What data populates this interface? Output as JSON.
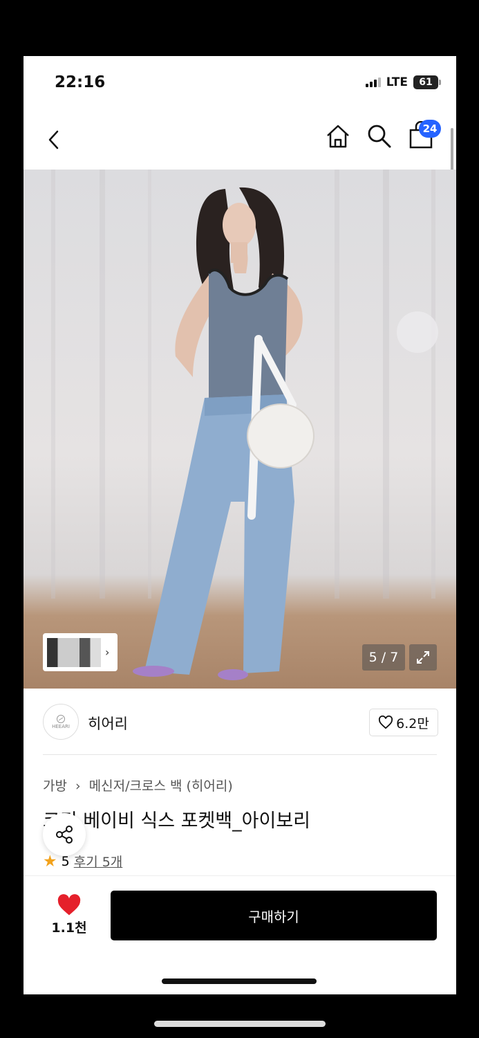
{
  "status_bar": {
    "time": "22:16",
    "network": "LTE",
    "battery": "61"
  },
  "nav": {
    "cart_count": "24"
  },
  "gallery": {
    "counter": "5 / 7"
  },
  "brand": {
    "name": "히어리",
    "logo_text": "HEEARI",
    "likes": "6.2만"
  },
  "breadcrumb": [
    "가방",
    "메신저/크로스 백 (히어리)"
  ],
  "product": {
    "title": "코티 베이비 식스 포켓백_아이보리",
    "rating": "5",
    "reviews": "후기 5개"
  },
  "bottom_bar": {
    "wish_count": "1.1천",
    "buy_label": "구매하기"
  },
  "colors": {
    "accent_blue": "#2563ff",
    "heart_red": "#e5202b",
    "star": "#f2a21c",
    "buy_bg": "#000000"
  }
}
